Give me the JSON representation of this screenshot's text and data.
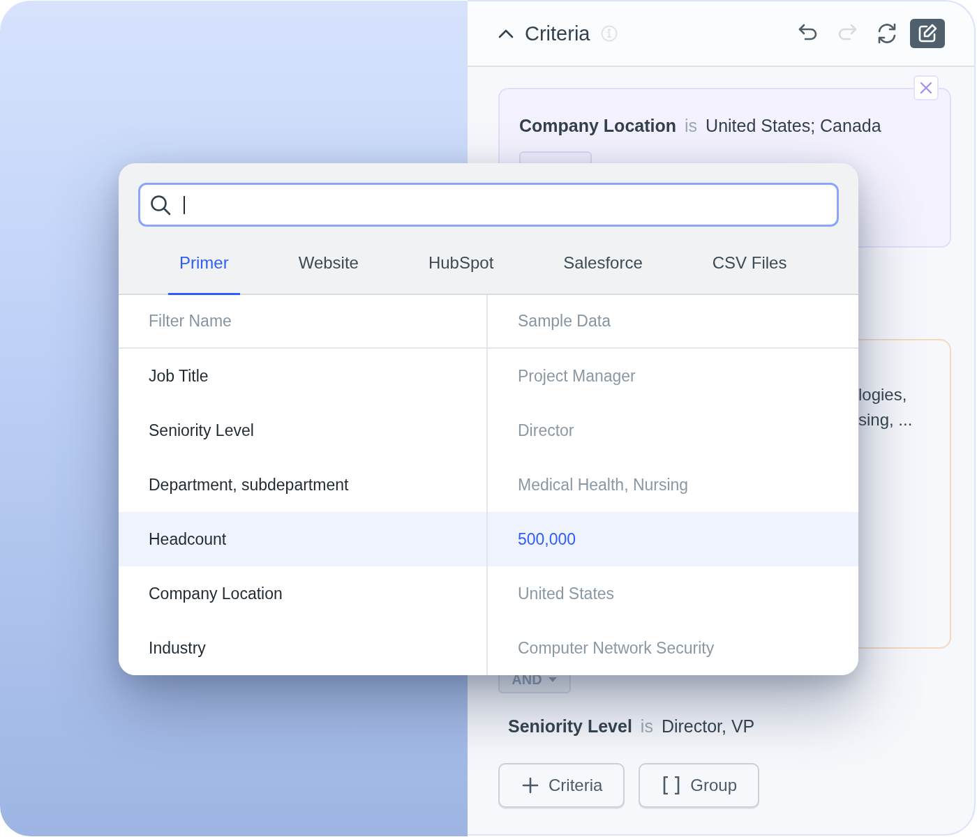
{
  "panel": {
    "title": "Criteria",
    "toolbar": [
      {
        "kind": "undo",
        "disabled": false
      },
      {
        "kind": "redo",
        "disabled": true
      },
      {
        "kind": "refresh",
        "disabled": false
      },
      {
        "kind": "edit"
      }
    ],
    "location_rule": {
      "field": "Company Location",
      "operator": "is",
      "value": "United States; Canada"
    },
    "industry_rule": {
      "value_lines": [
        "logies,",
        "sing, ..."
      ]
    },
    "connector": {
      "label": "AND"
    },
    "seniority_rule": {
      "field": "Seniority Level",
      "operator": "is",
      "value": "Director, VP"
    },
    "actions": [
      {
        "kind": "add",
        "label": "Criteria"
      },
      {
        "kind": "group",
        "label": "Group"
      }
    ]
  },
  "picker": {
    "tabs": [
      {
        "label": "Primer",
        "selected": true
      },
      {
        "label": "Website",
        "selected": false
      },
      {
        "label": "HubSpot",
        "selected": false
      },
      {
        "label": "Salesforce",
        "selected": false
      },
      {
        "label": "CSV Files",
        "selected": false
      }
    ],
    "columns": [
      "Filter Name",
      "Sample Data"
    ],
    "rows": [
      {
        "name": "Job Title",
        "sample": "Project Manager",
        "selected": false
      },
      {
        "name": "Seniority Level",
        "sample": "Director",
        "selected": false
      },
      {
        "name": "Department, subdepartment",
        "sample": "Medical Health, Nursing",
        "selected": false
      },
      {
        "name": "Headcount",
        "sample": "500,000",
        "selected": true
      },
      {
        "name": "Company Location",
        "sample": "United States",
        "selected": false
      },
      {
        "name": "Industry",
        "sample": "Computer Network Security",
        "selected": false
      }
    ]
  }
}
